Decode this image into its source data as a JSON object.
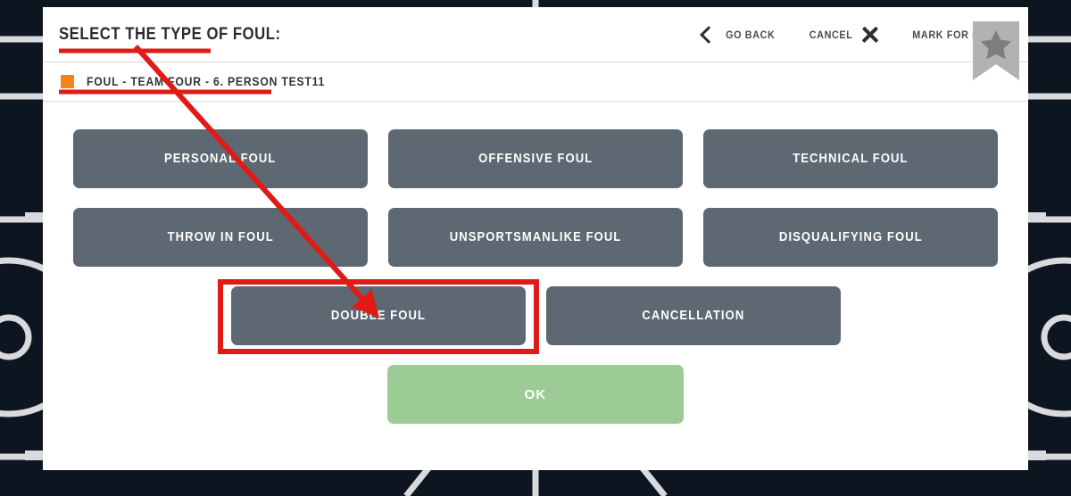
{
  "modal": {
    "title": "SELECT THE TYPE OF FOUL:",
    "header_actions": {
      "go_back": "GO BACK",
      "cancel": "CANCEL",
      "mark_for_review": "MARK FOR REVIEW"
    },
    "breadcrumb": {
      "swatch_color": "#f5821f",
      "text": "FOUL  -  TEAM FOUR  -   6.  PERSON TEST11"
    },
    "foul_options": [
      {
        "label": "PERSONAL FOUL"
      },
      {
        "label": "OFFENSIVE FOUL"
      },
      {
        "label": "TECHNICAL FOUL"
      },
      {
        "label": "THROW IN FOUL"
      },
      {
        "label": "UNSPORTSMANLIKE FOUL"
      },
      {
        "label": "DISQUALIFYING FOUL"
      },
      {
        "label": "DOUBLE FOUL"
      },
      {
        "label": "CANCELLATION"
      }
    ],
    "confirm": {
      "label": "OK"
    }
  },
  "colors": {
    "court_background": "#0d1520",
    "court_lines": "#d8dadd",
    "modal_background": "#ffffff",
    "button": "#5d6872",
    "button_text": "#ffffff",
    "confirm_button": "#9ccb95",
    "accent_orange": "#f5821f",
    "annotation_red": "#e01b16",
    "ribbon_gray": "#b2b2b2",
    "ribbon_star": "#7d7d7d",
    "text_dark": "#2b2b2b"
  },
  "annotations": {
    "title_underline": "red underline beneath SELECT THE TYPE OF FOUL:",
    "breadcrumb_underline": "red underline beneath breadcrumb row",
    "arrow": "red arrow from title area to DOUBLE FOUL button",
    "highlight_box": "red rectangle around DOUBLE FOUL button"
  },
  "icons": {
    "go_back": "chevron-left-icon",
    "cancel": "close-x-icon",
    "mark_for_review": "bookmark-star-icon"
  }
}
